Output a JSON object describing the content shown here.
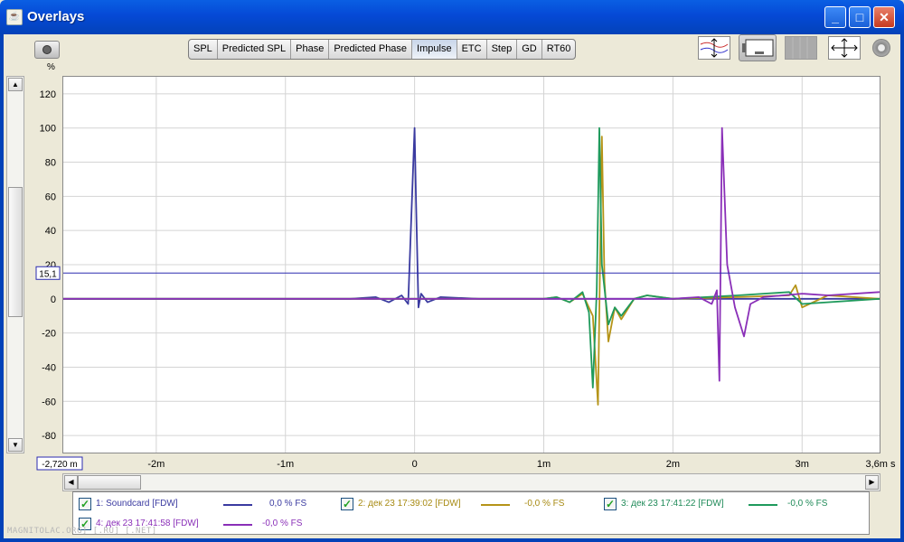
{
  "window": {
    "title": "Overlays",
    "app_icon": "java-cup-icon"
  },
  "window_controls": {
    "minimize": "_",
    "maximize": "□",
    "close": "✕"
  },
  "tabs": [
    {
      "label": "SPL",
      "active": false
    },
    {
      "label": "Predicted SPL",
      "active": false
    },
    {
      "label": "Phase",
      "active": false
    },
    {
      "label": "Predicted Phase",
      "active": false
    },
    {
      "label": "Impulse",
      "active": true
    },
    {
      "label": "ETC",
      "active": false
    },
    {
      "label": "Step",
      "active": false
    },
    {
      "label": "GD",
      "active": false
    },
    {
      "label": "RT60",
      "active": false
    }
  ],
  "toolbar_icons": [
    "graph-layout-icon",
    "control-panel-icon",
    "grid-icon",
    "axis-limits-icon",
    "settings-gear-icon"
  ],
  "plot": {
    "y_unit": "%",
    "cursor_y_label": "15,1",
    "cursor_x_label": "-2,720 m",
    "x_end_label": "3,6m s"
  },
  "chart_data": {
    "type": "line",
    "ylabel": "%",
    "xlabel": "",
    "xlim": [
      -2.72,
      3.6
    ],
    "ylim": [
      -90,
      130
    ],
    "x_ticks": [
      {
        "value": -2,
        "label": "-2m"
      },
      {
        "value": -1,
        "label": "-1m"
      },
      {
        "value": 0,
        "label": "0"
      },
      {
        "value": 1,
        "label": "1m"
      },
      {
        "value": 2,
        "label": "2m"
      },
      {
        "value": 3,
        "label": "3m"
      }
    ],
    "y_ticks": [
      120,
      100,
      80,
      60,
      40,
      20,
      0,
      -20,
      -40,
      -60,
      -80
    ],
    "cursor_y_value": 15.1,
    "series": [
      {
        "name": "1: Soundcard [FDW]",
        "color": "#3a3aa0",
        "x": [
          -2.72,
          -0.5,
          -0.3,
          -0.2,
          -0.1,
          -0.05,
          0.0,
          0.01,
          0.03,
          0.05,
          0.1,
          0.2,
          0.5,
          1.0,
          3.6
        ],
        "y": [
          0,
          0,
          1,
          -2,
          2,
          -3,
          100,
          60,
          -5,
          3,
          -2,
          1,
          0,
          0,
          0
        ]
      },
      {
        "name": "2: дек 23 17:39:02 [FDW]",
        "color": "#b59418",
        "x": [
          -2.72,
          1.0,
          1.1,
          1.2,
          1.3,
          1.38,
          1.42,
          1.45,
          1.47,
          1.5,
          1.55,
          1.6,
          1.7,
          1.8,
          2.0,
          2.5,
          2.9,
          2.95,
          3.0,
          3.2,
          3.6
        ],
        "y": [
          0,
          0,
          1,
          -2,
          3,
          -10,
          -62,
          95,
          10,
          -25,
          -5,
          -12,
          0,
          2,
          0,
          1,
          2,
          8,
          -5,
          2,
          0
        ]
      },
      {
        "name": "3: дек 23 17:41:22 [FDW]",
        "color": "#1f9a5c",
        "x": [
          -2.72,
          1.0,
          1.1,
          1.2,
          1.3,
          1.35,
          1.38,
          1.41,
          1.43,
          1.45,
          1.5,
          1.55,
          1.6,
          1.7,
          1.8,
          2.0,
          2.5,
          2.9,
          3.0,
          3.6
        ],
        "y": [
          0,
          0,
          1,
          -2,
          4,
          -8,
          -52,
          5,
          100,
          20,
          -15,
          -5,
          -10,
          0,
          2,
          0,
          2,
          4,
          -3,
          0
        ]
      },
      {
        "name": "4: дек 23 17:41:58 [FDW]",
        "color": "#8a2fb8",
        "x": [
          -2.72,
          1.5,
          2.0,
          2.2,
          2.3,
          2.34,
          2.36,
          2.38,
          2.42,
          2.48,
          2.55,
          2.6,
          2.7,
          3.0,
          3.2,
          3.6
        ],
        "y": [
          0,
          0,
          0,
          1,
          -3,
          5,
          -48,
          100,
          20,
          -5,
          -22,
          -3,
          1,
          3,
          2,
          4
        ]
      }
    ]
  },
  "legend": [
    {
      "label": "1: Soundcard [FDW]",
      "value": "0,0 % FS",
      "color": "#3a3aa0",
      "text_color": "#3a3aa0",
      "checked": true
    },
    {
      "label": "2: дек 23 17:39:02 [FDW]",
      "value": "-0,0 % FS",
      "color": "#b59418",
      "text_color": "#a78a12",
      "checked": true
    },
    {
      "label": "3: дек 23 17:41:22 [FDW]",
      "value": "-0,0 % FS",
      "color": "#1f9a5c",
      "text_color": "#1f8a58",
      "checked": true
    },
    {
      "label": "4: дек 23 17:41:58 [FDW]",
      "value": "-0,0 % FS",
      "color": "#8a2fb8",
      "text_color": "#8a2fb8",
      "checked": true
    }
  ],
  "watermark": "MAGNITOLAC.ORG] [.RU] [.NET]"
}
